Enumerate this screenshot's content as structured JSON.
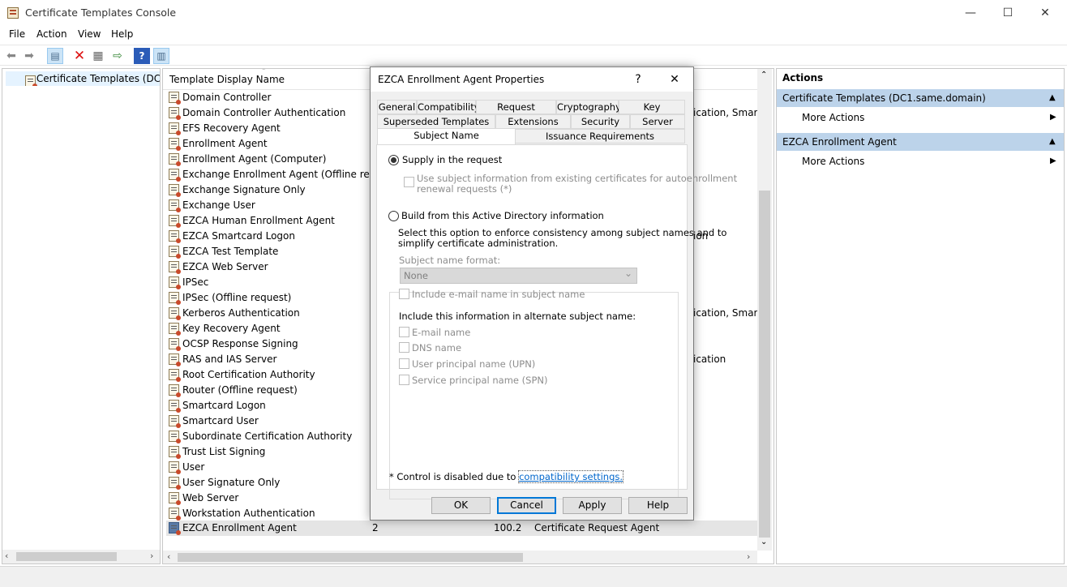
{
  "window": {
    "title": "Certificate Templates Console",
    "minimize": "—",
    "maximize": "☐",
    "close": "✕"
  },
  "menu": [
    "File",
    "Action",
    "View",
    "Help"
  ],
  "tree": {
    "root_label": "Certificate Templates (DC1.same.domain)"
  },
  "list": {
    "column_header": "Template Display Name",
    "items": [
      "Domain Controller",
      "Domain Controller Authentication",
      "EFS Recovery Agent",
      "Enrollment Agent",
      "Enrollment Agent (Computer)",
      "Exchange Enrollment Agent (Offline requ...",
      "Exchange Signature Only",
      "Exchange User",
      "EZCA Human Enrollment Agent",
      "EZCA Smartcard Logon",
      "EZCA Test Template",
      "EZCA Web Server",
      "IPSec",
      "IPSec (Offline request)",
      "Kerberos Authentication",
      "Key Recovery Agent",
      "OCSP Response Signing",
      "RAS and IAS Server",
      "Root Certification Authority",
      "Router (Offline request)",
      "Smartcard Logon",
      "Smartcard User",
      "Subordinate Certification Authority",
      "Trust List Signing",
      "User",
      "User Signature Only",
      "Web Server",
      "Workstation Authentication"
    ],
    "partial_cells": {
      "row1": "ication, Smart C",
      "row9": "ion",
      "row14": "ication, Smart C",
      "row17": "ication"
    },
    "selected_row": {
      "name": "EZCA Enrollment Agent",
      "schema": "2",
      "version": "100.2",
      "purpose": "Certificate Request Agent"
    }
  },
  "actions": {
    "header": "Actions",
    "sections": [
      {
        "title": "Certificate Templates (DC1.same.domain)",
        "item": "More Actions"
      },
      {
        "title": "EZCA Enrollment Agent",
        "item": "More Actions"
      }
    ]
  },
  "dialog": {
    "title": "EZCA Enrollment Agent Properties",
    "help": "?",
    "close": "✕",
    "tabs_row1": [
      "General",
      "Compatibility",
      "Request Handling",
      "Cryptography",
      "Key Attestation"
    ],
    "tabs_row2": [
      "Superseded Templates",
      "Extensions",
      "Security",
      "Server"
    ],
    "tabs_row3": [
      "Subject Name",
      "Issuance Requirements"
    ],
    "supply_label": "Supply in the request",
    "use_subject_info_line1": "Use subject information from existing certificates for autoenrollment",
    "use_subject_info_line2": "renewal requests (*)",
    "build_label": "Build from this Active Directory information",
    "build_desc_line1": "Select this option to enforce consistency among subject names and to",
    "build_desc_line2": "simplify certificate administration.",
    "name_format_label": "Subject name format:",
    "name_format_value": "None",
    "include_email_label": "Include e-mail name in subject name",
    "alt_name_label": "Include this information in alternate subject name:",
    "alt_options": [
      "E-mail name",
      "DNS name",
      "User principal name (UPN)",
      "Service principal name (SPN)"
    ],
    "footnote_prefix": "* Control is disabled due to ",
    "footnote_link": "compatibility settings.",
    "buttons": {
      "ok": "OK",
      "cancel": "Cancel",
      "apply": "Apply",
      "help": "Help"
    }
  }
}
